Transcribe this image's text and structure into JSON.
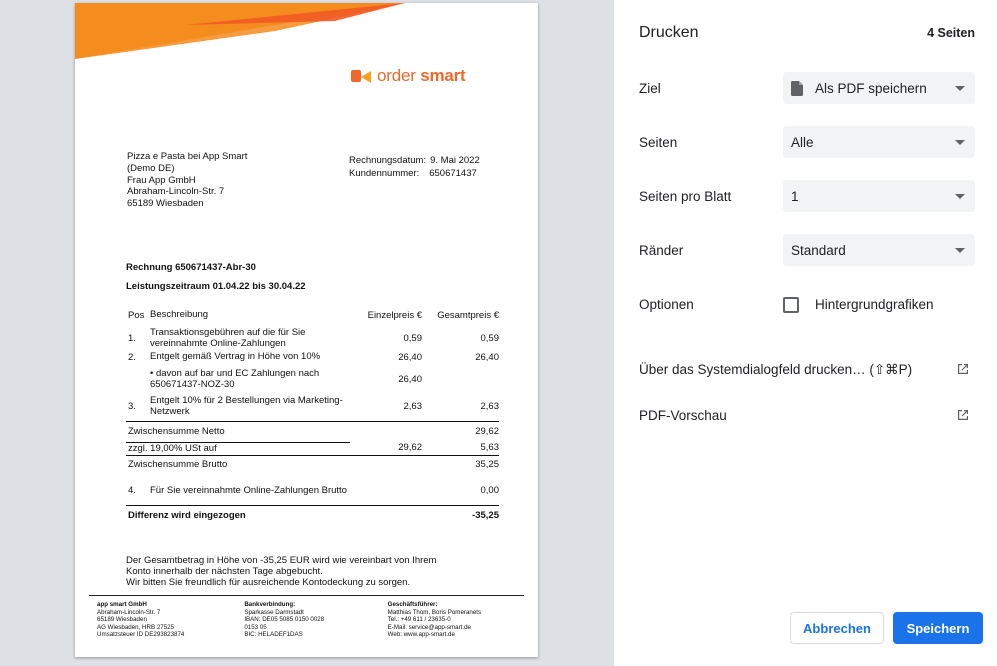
{
  "preview": {
    "logo": {
      "part1": "order",
      "part2": "smart",
      "brand_color": "#ef6a2a"
    },
    "recipient": [
      "Pizza e Pasta bei App Smart",
      "(Demo DE)",
      "Frau App GmbH",
      "Abraham-Lincoln-Str. 7",
      "65189 Wiesbaden"
    ],
    "meta": {
      "date_label": "Rechnungsdatum:",
      "date_value": "9. Mai 2022",
      "customer_label": "Kundennummer:",
      "customer_value": "650671437"
    },
    "invoice_no": "Rechnung 650671437-Abr-30",
    "period": "Leistungszeitraum 01.04.22 bis 30.04.22",
    "table": {
      "headers": {
        "pos": "Pos",
        "desc": "Beschreibung",
        "unit": "Einzelpreis €",
        "total": "Gesamtpreis €"
      },
      "rows": [
        {
          "pos": "1.",
          "desc": "Transaktionsgebühren auf die für Sie vereinnahmte Online-Zahlungen",
          "unit": "0,59",
          "total": "0,59"
        },
        {
          "pos": "2.",
          "desc": "Entgelt gemäß Vertrag in Höhe von 10%",
          "unit": "26,40",
          "total": "26,40"
        },
        {
          "pos": "",
          "desc": "• davon auf bar und EC Zahlungen nach 650671437-NOZ-30",
          "unit": "26,40",
          "total": ""
        },
        {
          "pos": "3.",
          "desc": "Entgelt 10% für 2 Bestellungen via Marketing-Netzwerk",
          "unit": "2,63",
          "total": "2,63"
        }
      ],
      "subtotal_net": {
        "label": "Zwischensumme Netto",
        "total": "29,62"
      },
      "vat": {
        "label": "zzgl. 19,00% USt auf",
        "unit": "29,62",
        "total": "5,63"
      },
      "subtotal_gross": {
        "label": "Zwischensumme Brutto",
        "total": "35,25"
      },
      "row4": {
        "pos": "4.",
        "desc": "Für Sie vereinnahmte Online-Zahlungen Brutto",
        "total": "0,00"
      },
      "difference": {
        "label": "Differenz wird eingezogen",
        "total": "-35,25"
      }
    },
    "closing": [
      "Der Gesamtbetrag in Höhe von -35,25 EUR wird wie vereinbart von Ihrem",
      "Konto innerhalb der nächsten Tage abgebucht.",
      "Wir bitten Sie freundlich für ausreichende Kontodeckung zu sorgen."
    ],
    "footer": {
      "company": {
        "head": "app smart GmbH",
        "lines": [
          "Abraham-Lincoln-Str. 7",
          "65189 Wiesbaden",
          "AG Wiesbaden, HRB 27525",
          "Umsatzsteuer ID DE293823874"
        ]
      },
      "bank": {
        "head": "Bankverbindung:",
        "lines": [
          "Sparkasse Darmstadt",
          "IBAN: DE05 5085 0150 0028",
          "0153 05",
          "BIC: HELADEF1DAS"
        ]
      },
      "management": {
        "head": "Geschäftsführer:",
        "lines": [
          "Matthias Thom, Boris Pomeranets",
          "Tel.: +49 611 / 23635-0",
          "E-Mail: service@app-smart.de",
          "Web: www.app-smart.de"
        ]
      }
    }
  },
  "panel": {
    "title": "Drucken",
    "page_count": "4 Seiten",
    "destination": {
      "label": "Ziel",
      "value": "Als PDF speichern",
      "icon": "pdf-file-icon"
    },
    "pages": {
      "label": "Seiten",
      "value": "Alle"
    },
    "pages_per_sheet": {
      "label": "Seiten pro Blatt",
      "value": "1"
    },
    "margins": {
      "label": "Ränder",
      "value": "Standard"
    },
    "options": {
      "label": "Optionen",
      "checkbox_label": "Hintergrundgrafiken",
      "checked": false
    },
    "system_dialog": {
      "label": "Über das Systemdialogfeld drucken… (⇧⌘P)",
      "icon": "open-in-new-icon"
    },
    "pdf_preview": {
      "label": "PDF-Vorschau",
      "icon": "open-in-new-icon"
    },
    "cancel_label": "Abbrechen",
    "save_label": "Speichern",
    "accent_color": "#1a73e8"
  }
}
